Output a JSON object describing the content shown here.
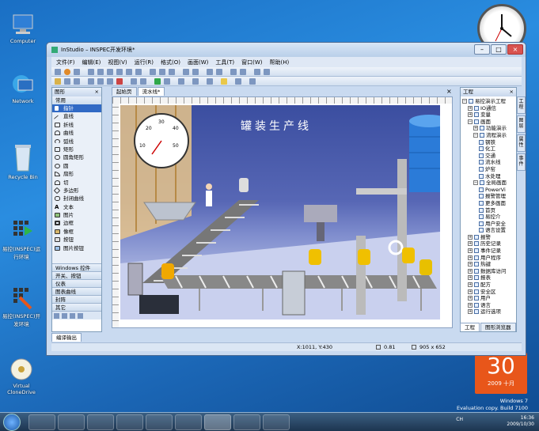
{
  "desktop": {
    "icons": [
      {
        "label": "Computer"
      },
      {
        "label": "Network"
      },
      {
        "label": "Recycle Bin"
      },
      {
        "label": "易控(INSPEC)运行环境"
      },
      {
        "label": "易控(INSPEC)开发环境"
      },
      {
        "label": "Virtual CloneDrive"
      }
    ],
    "calendar": {
      "day": "30",
      "month": "2009 十月"
    },
    "watermark": {
      "line1": "Windows 7",
      "line2": "Evaluation copy. Build 7100"
    }
  },
  "taskbar": {
    "language": "CH",
    "time": "16:36",
    "date": "2009/10/30"
  },
  "window": {
    "title": "InStudio – INSPEC开发环境*",
    "menu": [
      "文件(F)",
      "编辑(E)",
      "视图(V)",
      "运行(R)",
      "格式(O)",
      "画面(W)",
      "工具(T)",
      "窗口(W)",
      "帮助(H)"
    ],
    "tabs": [
      "起始页",
      "流水线*"
    ]
  },
  "shapes_panel": {
    "title": "图形",
    "section": "常用",
    "items": [
      "指针",
      "直线",
      "折线",
      "曲线",
      "弧线",
      "矩形",
      "圆角矩形",
      "圆",
      "扇形",
      "切",
      "多边形",
      "封闭曲线",
      "文本",
      "图片",
      "边框",
      "像框",
      "按钮",
      "图片按钮"
    ],
    "categories": [
      "Windows 控件",
      "开关、按钮",
      "仪表",
      "图表曲线",
      "封阵",
      "其它"
    ]
  },
  "canvas": {
    "scene_title": "罐装生产线",
    "gauge_labels": [
      "10",
      "20",
      "30",
      "40",
      "50"
    ]
  },
  "bottom_tab": "编译输出",
  "status": {
    "coords": "X:1011, Y:430",
    "zoom": "0.81",
    "size": "905 x 652"
  },
  "project_panel": {
    "title": "工程",
    "tree": [
      {
        "label": "易控演示工程",
        "level": 0
      },
      {
        "label": "IO通信",
        "level": 1
      },
      {
        "label": "变量",
        "level": 1
      },
      {
        "label": "画面",
        "level": 1
      },
      {
        "label": "功能演示",
        "level": 2
      },
      {
        "label": "流程演示",
        "level": 2
      },
      {
        "label": "钢铁",
        "level": 3
      },
      {
        "label": "化工",
        "level": 3
      },
      {
        "label": "交通",
        "level": 3
      },
      {
        "label": "流水线",
        "level": 3
      },
      {
        "label": "炉窑",
        "level": 3
      },
      {
        "label": "水处理",
        "level": 3
      },
      {
        "label": "全局画面",
        "level": 2
      },
      {
        "label": "PowerVi",
        "level": 3
      },
      {
        "label": "报警管理",
        "level": 3
      },
      {
        "label": "更多画面",
        "level": 3
      },
      {
        "label": "首页",
        "level": 3
      },
      {
        "label": "易控介",
        "level": 3
      },
      {
        "label": "用户安全",
        "level": 3
      },
      {
        "label": "语言设置",
        "level": 3
      },
      {
        "label": "报警",
        "level": 1
      },
      {
        "label": "历史记录",
        "level": 1
      },
      {
        "label": "事件记录",
        "level": 1
      },
      {
        "label": "用户程序",
        "level": 1
      },
      {
        "label": "热键",
        "level": 1
      },
      {
        "label": "数据库访问",
        "level": 1
      },
      {
        "label": "报表",
        "level": 1
      },
      {
        "label": "配方",
        "level": 1
      },
      {
        "label": "安全区",
        "level": 1
      },
      {
        "label": "用户",
        "level": 1
      },
      {
        "label": "语言",
        "level": 1
      },
      {
        "label": "运行选项",
        "level": 1
      }
    ],
    "bottom_tabs": [
      "工程",
      "图形浏览器"
    ],
    "side_tabs": [
      "工程",
      "图层",
      "属性",
      "事件"
    ]
  },
  "colors": {
    "select": "#316ac5",
    "accent": "#e8561a"
  }
}
